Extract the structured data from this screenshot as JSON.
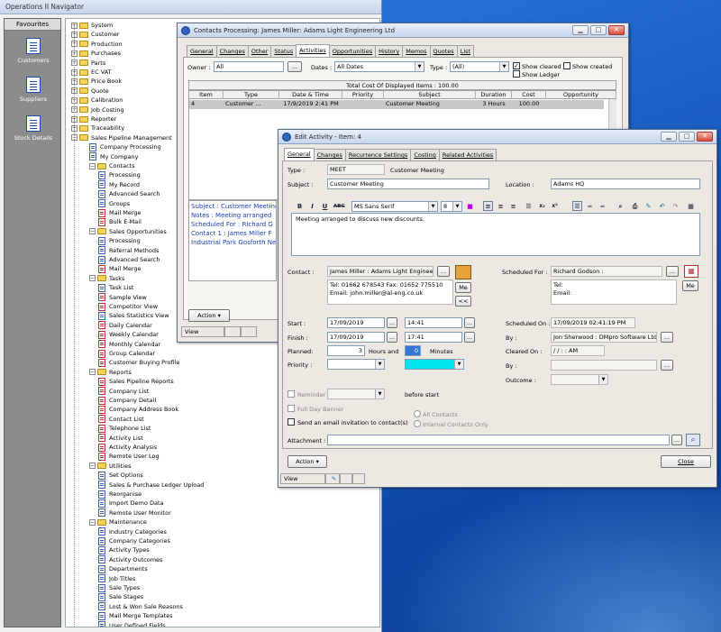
{
  "navigator": {
    "title": "Operations II Navigator",
    "favourites_label": "Favourites",
    "favourites": [
      {
        "label": "Customers",
        "icon": "customers-icon"
      },
      {
        "label": "Suppliers",
        "icon": "suppliers-icon"
      },
      {
        "label": "Stock Details",
        "icon": "stock-details-icon"
      }
    ],
    "tree": [
      {
        "level": 0,
        "type": "folder",
        "exp": "+",
        "label": "System"
      },
      {
        "level": 0,
        "type": "folder",
        "exp": "+",
        "label": "Customer"
      },
      {
        "level": 0,
        "type": "folder",
        "exp": "+",
        "label": "Production"
      },
      {
        "level": 0,
        "type": "folder",
        "exp": "+",
        "label": "Purchases"
      },
      {
        "level": 0,
        "type": "folder",
        "exp": "+",
        "label": "Parts"
      },
      {
        "level": 0,
        "type": "folder",
        "exp": "+",
        "label": "EC VAT"
      },
      {
        "level": 0,
        "type": "folder",
        "exp": "+",
        "label": "Price Book"
      },
      {
        "level": 0,
        "type": "folder",
        "exp": "+",
        "label": "Quote"
      },
      {
        "level": 0,
        "type": "folder",
        "exp": "+",
        "label": "Calibration"
      },
      {
        "level": 0,
        "type": "folder",
        "exp": "+",
        "label": "Job Costing"
      },
      {
        "level": 0,
        "type": "folder",
        "exp": "+",
        "label": "Reporter"
      },
      {
        "level": 0,
        "type": "folder",
        "exp": "+",
        "label": "Traceability"
      },
      {
        "level": 0,
        "type": "folder",
        "exp": "-",
        "label": "Sales Pipeline Management"
      },
      {
        "level": 1,
        "type": "doc",
        "label": "Company Processing"
      },
      {
        "level": 1,
        "type": "doc",
        "label": "My Company"
      },
      {
        "level": 1,
        "type": "folder",
        "exp": "-",
        "label": "Contacts"
      },
      {
        "level": 2,
        "type": "doc",
        "label": "Processing"
      },
      {
        "level": 2,
        "type": "doc",
        "label": "My Record"
      },
      {
        "level": 2,
        "type": "doc",
        "label": "Advanced Search"
      },
      {
        "level": 2,
        "type": "doc",
        "label": "Groups"
      },
      {
        "level": 2,
        "type": "pen",
        "label": "Mail Merge"
      },
      {
        "level": 2,
        "type": "pen",
        "label": "Bulk E-Mail"
      },
      {
        "level": 1,
        "type": "folder",
        "exp": "-",
        "label": "Sales Opportunities"
      },
      {
        "level": 2,
        "type": "doc",
        "label": "Processing"
      },
      {
        "level": 2,
        "type": "doc",
        "label": "Referral Methods"
      },
      {
        "level": 2,
        "type": "doc",
        "label": "Advanced Search"
      },
      {
        "level": 2,
        "type": "pen",
        "label": "Mail Merge"
      },
      {
        "level": 1,
        "type": "folder",
        "exp": "-",
        "label": "Tasks"
      },
      {
        "level": 2,
        "type": "doc",
        "label": "Task List"
      },
      {
        "level": 2,
        "type": "pen",
        "label": "Sample View"
      },
      {
        "level": 2,
        "type": "pen",
        "label": "Competitor View"
      },
      {
        "level": 2,
        "type": "doc",
        "label": "Sales Statistics View"
      },
      {
        "level": 2,
        "type": "pen",
        "label": "Daily Calendar"
      },
      {
        "level": 2,
        "type": "pen",
        "label": "Weekly Calendar"
      },
      {
        "level": 2,
        "type": "pen",
        "label": "Monthly Calendar"
      },
      {
        "level": 2,
        "type": "pen",
        "label": "Group Calendar"
      },
      {
        "level": 2,
        "type": "pen",
        "label": "Customer Buying Profile"
      },
      {
        "level": 1,
        "type": "folder",
        "exp": "-",
        "label": "Reports"
      },
      {
        "level": 2,
        "type": "pen",
        "label": "Sales Pipeline Reports"
      },
      {
        "level": 2,
        "type": "pen",
        "label": "Company List"
      },
      {
        "level": 2,
        "type": "pen",
        "label": "Company Detail"
      },
      {
        "level": 2,
        "type": "pen",
        "label": "Company Address Book"
      },
      {
        "level": 2,
        "type": "pen",
        "label": "Contact List"
      },
      {
        "level": 2,
        "type": "pen",
        "label": "Telephone List"
      },
      {
        "level": 2,
        "type": "pen",
        "label": "Activity List"
      },
      {
        "level": 2,
        "type": "pen",
        "label": "Activity Analysis"
      },
      {
        "level": 2,
        "type": "pen",
        "label": "Remote User Log"
      },
      {
        "level": 1,
        "type": "folder",
        "exp": "-",
        "label": "Utilities"
      },
      {
        "level": 2,
        "type": "doc",
        "label": "Set Options"
      },
      {
        "level": 2,
        "type": "doc",
        "label": "Sales & Purchase Ledger Upload"
      },
      {
        "level": 2,
        "type": "doc",
        "label": "Reorganise"
      },
      {
        "level": 2,
        "type": "doc",
        "label": "Import Demo Data"
      },
      {
        "level": 2,
        "type": "doc",
        "label": "Remote User Monitor"
      },
      {
        "level": 1,
        "type": "folder",
        "exp": "-",
        "label": "Maintenance"
      },
      {
        "level": 2,
        "type": "doc",
        "label": "Industry Categories"
      },
      {
        "level": 2,
        "type": "doc",
        "label": "Company Categories"
      },
      {
        "level": 2,
        "type": "doc",
        "label": "Activity Types"
      },
      {
        "level": 2,
        "type": "doc",
        "label": "Activity Outcomes"
      },
      {
        "level": 2,
        "type": "doc",
        "label": "Departments"
      },
      {
        "level": 2,
        "type": "doc",
        "label": "Job Titles"
      },
      {
        "level": 2,
        "type": "doc",
        "label": "Sale Types"
      },
      {
        "level": 2,
        "type": "doc",
        "label": "Sale Stages"
      },
      {
        "level": 2,
        "type": "doc",
        "label": "Lost & Won Sale Reasons"
      },
      {
        "level": 2,
        "type": "doc",
        "label": "Mail Merge Templates"
      },
      {
        "level": 2,
        "type": "doc",
        "label": "User Defined Fields"
      }
    ]
  },
  "contacts_window": {
    "title": "Contacts Processing: James Miller: Adams Light Engineering Ltd",
    "tabs": [
      "General",
      "Changes",
      "Other",
      "Status",
      "Activities",
      "Opportunities",
      "History",
      "Memos",
      "Quotes",
      "List"
    ],
    "active_tab": 4,
    "owner_label": "Owner :",
    "owner_value": "All",
    "owner_btn": "...",
    "dates_label": "Dates :",
    "dates_value": "All Dates",
    "type_label": "Type :",
    "type_value": "(All)",
    "show_cleared": "Show cleared",
    "show_created": "Show created",
    "show_ledger": "Show Ledger",
    "total_cost": "Total Cost Of Displayed Items : 100.00",
    "columns": [
      "Item",
      "Type",
      "Date & Time",
      "Priority",
      "Subject",
      "Duration",
      "Cost",
      "Opportunity"
    ],
    "rows": [
      [
        "4",
        "Customer ...",
        "17/9/2019 2:41 PM",
        "",
        "Customer Meeting",
        "3 Hours",
        "100.00",
        ""
      ]
    ],
    "notes_lines": [
      "Subject : Customer Meeting",
      "Notes : Meeting arranged",
      "Scheduled For : Richard G",
      "Contact 1 : James Miller  F",
      "Industrial Park Gosforth Ne"
    ],
    "action_btn": "Action",
    "status": "View"
  },
  "edit_window": {
    "title": "Edit Activity - Item: 4",
    "tabs": [
      "General",
      "Changes",
      "Recurrence Settings",
      "Costing",
      "Related Activities"
    ],
    "active_tab": 0,
    "type_label": "Type :",
    "type_code": "MEET",
    "type_desc": "Customer Meeting",
    "subject_label": "Subject :",
    "subject_value": "Customer Meeting",
    "location_label": "Location :",
    "location_value": "Adams HQ",
    "font_name": "MS Sans Serif",
    "font_size": "8",
    "notes_text": "Meeting arranged to discuss new discounts.",
    "contact_label": "Contact :",
    "contact_value": "James Miller : Adams Light Engineeri",
    "contact_details": [
      "Tel: 01662 678543 Fax: 01652 775510",
      "Email: john.miller@al-eng.co.uk"
    ],
    "me_btn": "Me",
    "swap_btn": "<<",
    "scheduled_for_label": "Scheduled For :",
    "scheduled_for_value": "Richard Godson :",
    "sched_details": [
      "Tel:",
      "Email:"
    ],
    "start_label": "Start :",
    "start_date": "17/09/2019",
    "start_time": "14:41",
    "finish_label": "Finish :",
    "finish_date": "17/09/2019",
    "finish_time": "17:41",
    "planned_label": "Planned:",
    "planned_hours": "3",
    "hours_and": "Hours and",
    "planned_minutes": "0",
    "minutes_label": "Minutes",
    "priority_label": "Priority :",
    "scheduled_on_label": "Scheduled On :",
    "scheduled_on_value": "17/09/2019 02:41:19 PM",
    "by_label": "By :",
    "by_value": "Jon Sherwood : DMpro Software Ltd",
    "cleared_on_label": "Cleared On :",
    "cleared_on_value": " /  /      :  :  AM",
    "by2_label": "By :",
    "outcome_label": "Outcome :",
    "reminder_label": "Reminder",
    "before_start": "before start",
    "full_day_label": "Full Day Banner",
    "send_email_label": "Send an email invitation to contact(s)",
    "all_contacts": "All Contacts",
    "internal_contacts": "Internal Contacts Only",
    "attachment_label": "Attachment :",
    "action_btn": "Action",
    "close_btn": "Close",
    "status": "View",
    "colors": {
      "color_swatch": "#00e5ee"
    }
  }
}
